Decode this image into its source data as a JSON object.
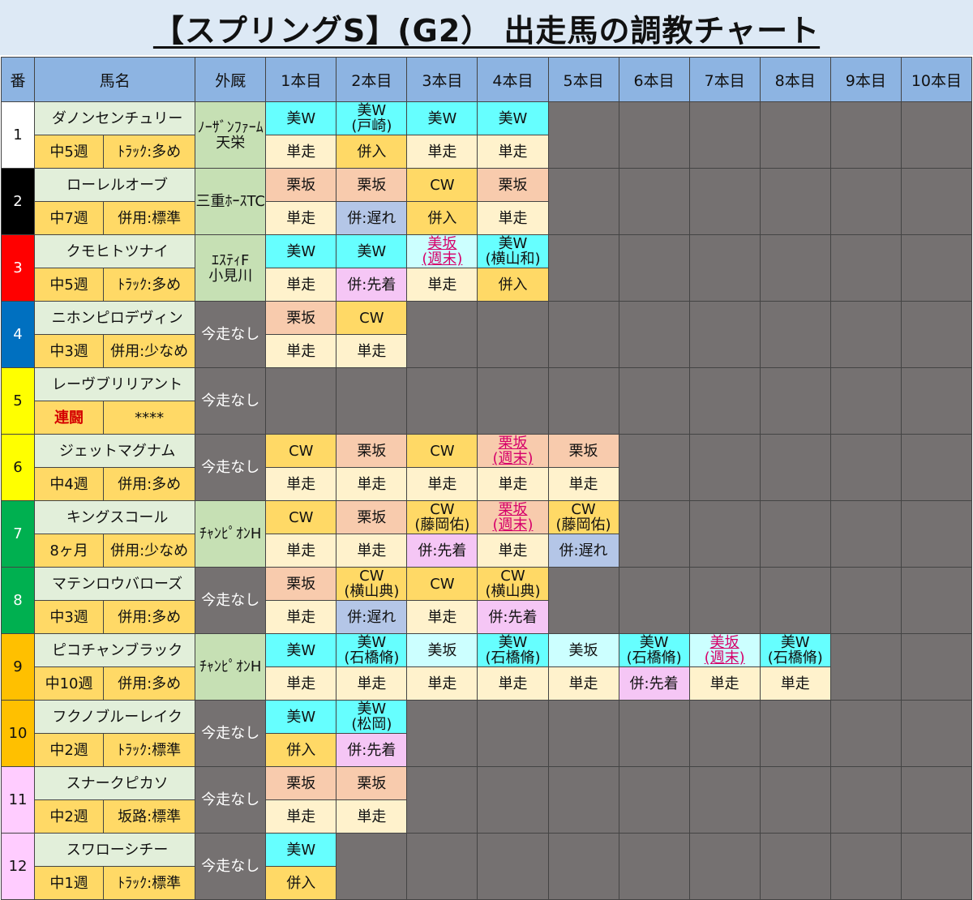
{
  "title": "【スプリングS】(G2） 出走馬の調教チャート",
  "headers": [
    "番",
    "馬名",
    "外厩",
    "1本目",
    "2本目",
    "3本目",
    "4本目",
    "5本目",
    "6本目",
    "7本目",
    "8本目",
    "9本目",
    "10本目"
  ],
  "horses": [
    {
      "num": "1",
      "name": "ダノンセンチュリー",
      "interval": "中5週",
      "style": "ﾄﾗｯｸ:多め",
      "stable": "ﾉｰｻﾞﾝﾌｧｰﾑ\n天栄",
      "sessions": [
        {
          "course": "美W",
          "partner": "",
          "type": "単走"
        },
        {
          "course": "美W",
          "partner": "(戸崎)",
          "type": "併入"
        },
        {
          "course": "美W",
          "partner": "",
          "type": "単走"
        },
        {
          "course": "美W",
          "partner": "",
          "type": "単走"
        }
      ]
    },
    {
      "num": "2",
      "name": "ローレルオーブ",
      "interval": "中7週",
      "style": "併用:標準",
      "stable": "三重ﾎｰｽTC",
      "sessions": [
        {
          "course": "栗坂",
          "partner": "",
          "type": "単走"
        },
        {
          "course": "栗坂",
          "partner": "",
          "type": "併:遅れ"
        },
        {
          "course": "CW",
          "partner": "",
          "type": "併入"
        },
        {
          "course": "栗坂",
          "partner": "",
          "type": "単走"
        }
      ]
    },
    {
      "num": "3",
      "name": "クモヒトツナイ",
      "interval": "中5週",
      "style": "ﾄﾗｯｸ:多め",
      "stable": "ｴｽﾃｨF\n小見川",
      "sessions": [
        {
          "course": "美W",
          "partner": "",
          "type": "単走"
        },
        {
          "course": "美W",
          "partner": "",
          "type": "併:先着"
        },
        {
          "course": "美坂",
          "partner": "(週末)",
          "type": "単走"
        },
        {
          "course": "美W",
          "partner": "(横山和)",
          "type": "併入"
        }
      ]
    },
    {
      "num": "4",
      "name": "ニホンピロデヴィン",
      "interval": "中3週",
      "style": "併用:少なめ",
      "stable": "今走なし",
      "sessions": [
        {
          "course": "栗坂",
          "partner": "",
          "type": "単走"
        },
        {
          "course": "CW",
          "partner": "",
          "type": "単走"
        }
      ]
    },
    {
      "num": "5",
      "name": "レーヴブリリアント",
      "interval": "連闘",
      "style": "****",
      "stable": "今走なし",
      "sessions": []
    },
    {
      "num": "6",
      "name": "ジェットマグナム",
      "interval": "中4週",
      "style": "併用:多め",
      "stable": "今走なし",
      "sessions": [
        {
          "course": "CW",
          "partner": "",
          "type": "単走"
        },
        {
          "course": "栗坂",
          "partner": "",
          "type": "単走"
        },
        {
          "course": "CW",
          "partner": "",
          "type": "単走"
        },
        {
          "course": "栗坂",
          "partner": "(週末)",
          "type": "単走"
        },
        {
          "course": "栗坂",
          "partner": "",
          "type": "単走"
        }
      ]
    },
    {
      "num": "7",
      "name": "キングスコール",
      "interval": "8ヶ月",
      "style": "併用:少なめ",
      "stable": "ﾁｬﾝﾋﾟｵﾝH",
      "sessions": [
        {
          "course": "CW",
          "partner": "",
          "type": "単走"
        },
        {
          "course": "栗坂",
          "partner": "",
          "type": "単走"
        },
        {
          "course": "CW",
          "partner": "(藤岡佑)",
          "type": "併:先着"
        },
        {
          "course": "栗坂",
          "partner": "(週末)",
          "type": "単走"
        },
        {
          "course": "CW",
          "partner": "(藤岡佑)",
          "type": "併:遅れ"
        }
      ]
    },
    {
      "num": "8",
      "name": "マテンロウバローズ",
      "interval": "中3週",
      "style": "併用:多め",
      "stable": "今走なし",
      "sessions": [
        {
          "course": "栗坂",
          "partner": "",
          "type": "単走"
        },
        {
          "course": "CW",
          "partner": "(横山典)",
          "type": "併:遅れ"
        },
        {
          "course": "CW",
          "partner": "",
          "type": "単走"
        },
        {
          "course": "CW",
          "partner": "(横山典)",
          "type": "併:先着"
        }
      ]
    },
    {
      "num": "9",
      "name": "ピコチャンブラック",
      "interval": "中10週",
      "style": "併用:多め",
      "stable": "ﾁｬﾝﾋﾟｵﾝH",
      "sessions": [
        {
          "course": "美W",
          "partner": "",
          "type": "単走"
        },
        {
          "course": "美W",
          "partner": "(石橋脩)",
          "type": "単走"
        },
        {
          "course": "美坂",
          "partner": "",
          "type": "単走"
        },
        {
          "course": "美W",
          "partner": "(石橋脩)",
          "type": "単走"
        },
        {
          "course": "美坂",
          "partner": "",
          "type": "単走"
        },
        {
          "course": "美W",
          "partner": "(石橋脩)",
          "type": "併:先着"
        },
        {
          "course": "美坂",
          "partner": "(週末)",
          "type": "単走"
        },
        {
          "course": "美W",
          "partner": "(石橋脩)",
          "type": "単走"
        }
      ]
    },
    {
      "num": "10",
      "name": "フクノブルーレイク",
      "interval": "中2週",
      "style": "ﾄﾗｯｸ:標準",
      "stable": "今走なし",
      "sessions": [
        {
          "course": "美W",
          "partner": "",
          "type": "併入"
        },
        {
          "course": "美W",
          "partner": "(松岡)",
          "type": "併:先着"
        }
      ]
    },
    {
      "num": "11",
      "name": "スナークピカソ",
      "interval": "中2週",
      "style": "坂路:標準",
      "stable": "今走なし",
      "sessions": [
        {
          "course": "栗坂",
          "partner": "",
          "type": "単走"
        },
        {
          "course": "栗坂",
          "partner": "",
          "type": "単走"
        }
      ]
    },
    {
      "num": "12",
      "name": "スワローシチー",
      "interval": "中1週",
      "style": "ﾄﾗｯｸ:標準",
      "stable": "今走なし",
      "sessions": [
        {
          "course": "美W",
          "partner": "",
          "type": "併入"
        }
      ]
    }
  ],
  "colors": {
    "header_bg": "#8db4e2",
    "frame_1": "#ffffff",
    "frame_2": "#000000",
    "frame_3": "#ff0000",
    "frame_4": "#0070c0",
    "frame_5": "#ffff00",
    "frame_6": "#ffff00",
    "frame_7": "#00b050",
    "frame_8": "#00b050",
    "frame_9": "#ffc000",
    "frame_10": "#ffc000",
    "frame_11": "#ffccff",
    "frame_12": "#ffccff",
    "empty_cell": "#757171",
    "name_bg": "#e2efda",
    "info_bg": "#ffd966"
  }
}
